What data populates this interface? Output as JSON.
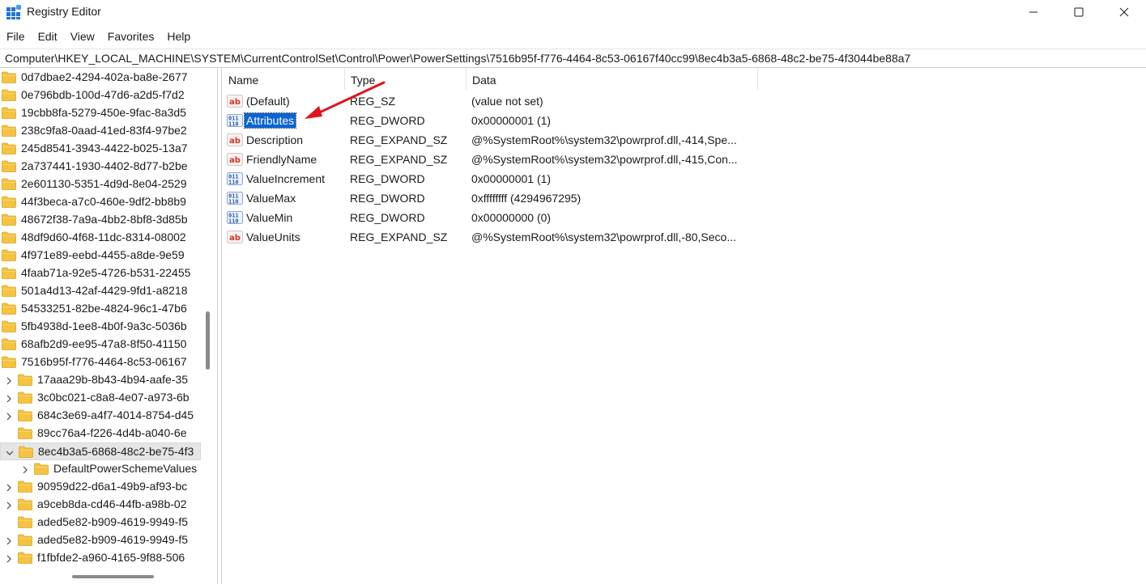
{
  "window": {
    "title": "Registry Editor",
    "controls": [
      "minimize",
      "maximize",
      "close"
    ]
  },
  "menu": [
    "File",
    "Edit",
    "View",
    "Favorites",
    "Help"
  ],
  "address": "Computer\\HKEY_LOCAL_MACHINE\\SYSTEM\\CurrentControlSet\\Control\\Power\\PowerSettings\\7516b95f-f776-4464-8c53-06167f40cc99\\8ec4b3a5-6868-48c2-be75-4f3044be88a7",
  "tree": [
    {
      "label": "0d7dbae2-4294-402a-ba8e-2677",
      "level": 0,
      "expander": "none",
      "selected": false
    },
    {
      "label": "0e796bdb-100d-47d6-a2d5-f7d2",
      "level": 0,
      "expander": "none",
      "selected": false
    },
    {
      "label": "19cbb8fa-5279-450e-9fac-8a3d5",
      "level": 0,
      "expander": "none",
      "selected": false
    },
    {
      "label": "238c9fa8-0aad-41ed-83f4-97be2",
      "level": 0,
      "expander": "none",
      "selected": false
    },
    {
      "label": "245d8541-3943-4422-b025-13a7",
      "level": 0,
      "expander": "none",
      "selected": false
    },
    {
      "label": "2a737441-1930-4402-8d77-b2be",
      "level": 0,
      "expander": "none",
      "selected": false
    },
    {
      "label": "2e601130-5351-4d9d-8e04-2529",
      "level": 0,
      "expander": "none",
      "selected": false
    },
    {
      "label": "44f3beca-a7c0-460e-9df2-bb8b9",
      "level": 0,
      "expander": "none",
      "selected": false
    },
    {
      "label": "48672f38-7a9a-4bb2-8bf8-3d85b",
      "level": 0,
      "expander": "none",
      "selected": false
    },
    {
      "label": "48df9d60-4f68-11dc-8314-08002",
      "level": 0,
      "expander": "none",
      "selected": false
    },
    {
      "label": "4f971e89-eebd-4455-a8de-9e59",
      "level": 0,
      "expander": "none",
      "selected": false
    },
    {
      "label": "4faab71a-92e5-4726-b531-22455",
      "level": 0,
      "expander": "none",
      "selected": false
    },
    {
      "label": "501a4d13-42af-4429-9fd1-a8218",
      "level": 0,
      "expander": "none",
      "selected": false
    },
    {
      "label": "54533251-82be-4824-96c1-47b6",
      "level": 0,
      "expander": "none",
      "selected": false
    },
    {
      "label": "5fb4938d-1ee8-4b0f-9a3c-5036b",
      "level": 0,
      "expander": "none",
      "selected": false
    },
    {
      "label": "68afb2d9-ee95-47a8-8f50-41150",
      "level": 0,
      "expander": "none",
      "selected": false
    },
    {
      "label": "7516b95f-f776-4464-8c53-06167",
      "level": 0,
      "expander": "none",
      "selected": false
    },
    {
      "label": "17aaa29b-8b43-4b94-aafe-35",
      "level": 1,
      "expander": "collapsed",
      "selected": false
    },
    {
      "label": "3c0bc021-c8a8-4e07-a973-6b",
      "level": 1,
      "expander": "collapsed",
      "selected": false
    },
    {
      "label": "684c3e69-a4f7-4014-8754-d45",
      "level": 1,
      "expander": "collapsed",
      "selected": false
    },
    {
      "label": "89cc76a4-f226-4d4b-a040-6e",
      "level": 1,
      "expander": "none",
      "selected": false
    },
    {
      "label": "8ec4b3a5-6868-48c2-be75-4f3",
      "level": 1,
      "expander": "expanded",
      "selected": true
    },
    {
      "label": "DefaultPowerSchemeValues",
      "level": 2,
      "expander": "collapsed",
      "selected": false
    },
    {
      "label": "90959d22-d6a1-49b9-af93-bc",
      "level": 1,
      "expander": "collapsed",
      "selected": false
    },
    {
      "label": "a9ceb8da-cd46-44fb-a98b-02",
      "level": 1,
      "expander": "collapsed",
      "selected": false
    },
    {
      "label": "aded5e82-b909-4619-9949-f5",
      "level": 1,
      "expander": "none",
      "selected": false
    },
    {
      "label": "aded5e82-b909-4619-9949-f5",
      "level": 1,
      "expander": "collapsed",
      "selected": false
    },
    {
      "label": "f1fbfde2-a960-4165-9f88-506",
      "level": 1,
      "expander": "collapsed",
      "selected": false
    }
  ],
  "list": {
    "columns": {
      "name": "Name",
      "type": "Type",
      "data": "Data"
    },
    "rows": [
      {
        "name": "(Default)",
        "type": "REG_SZ",
        "data": "(value not set)",
        "icon": "string-value-icon",
        "selected": false
      },
      {
        "name": "Attributes",
        "type": "REG_DWORD",
        "data": "0x00000001 (1)",
        "icon": "binary-value-icon",
        "selected": true
      },
      {
        "name": "Description",
        "type": "REG_EXPAND_SZ",
        "data": "@%SystemRoot%\\system32\\powrprof.dll,-414,Spe...",
        "icon": "string-value-icon",
        "selected": false
      },
      {
        "name": "FriendlyName",
        "type": "REG_EXPAND_SZ",
        "data": "@%SystemRoot%\\system32\\powrprof.dll,-415,Con...",
        "icon": "string-value-icon",
        "selected": false
      },
      {
        "name": "ValueIncrement",
        "type": "REG_DWORD",
        "data": "0x00000001 (1)",
        "icon": "binary-value-icon",
        "selected": false
      },
      {
        "name": "ValueMax",
        "type": "REG_DWORD",
        "data": "0xffffffff (4294967295)",
        "icon": "binary-value-icon",
        "selected": false
      },
      {
        "name": "ValueMin",
        "type": "REG_DWORD",
        "data": "0x00000000 (0)",
        "icon": "binary-value-icon",
        "selected": false
      },
      {
        "name": "ValueUnits",
        "type": "REG_EXPAND_SZ",
        "data": "@%SystemRoot%\\system32\\powrprof.dll,-80,Seco...",
        "icon": "string-value-icon",
        "selected": false
      }
    ]
  },
  "colors": {
    "selection": "#0a64d6",
    "folder": "#f5c342",
    "annotation_arrow": "#e0141e"
  }
}
